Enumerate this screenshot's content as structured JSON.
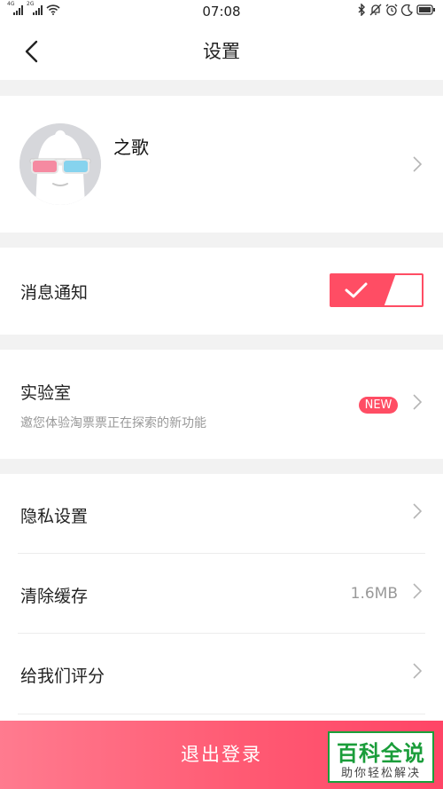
{
  "status_bar": {
    "network_1": "4G",
    "network_2": "2G",
    "time": "07:08"
  },
  "header": {
    "title": "设置",
    "back_icon": "chevron-left-icon"
  },
  "profile": {
    "name": "之歌",
    "avatar_icon": "avatar-mascot-3d-glasses"
  },
  "notifications": {
    "label": "消息通知",
    "toggle_on": true
  },
  "lab": {
    "label": "实验室",
    "subtitle": "邀您体验淘票票正在探索的新功能",
    "badge": "NEW"
  },
  "list": {
    "items": [
      {
        "label": "隐私设置",
        "value": ""
      },
      {
        "label": "清除缓存",
        "value": "1.6MB"
      },
      {
        "label": "给我们评分",
        "value": ""
      }
    ]
  },
  "logout": {
    "label": "退出登录"
  },
  "watermark": {
    "main": "百科全说",
    "sub": "助你轻松解决"
  },
  "colors": {
    "accent": "#ff4d64",
    "background": "#f2f2f2",
    "watermark_green": "#1a9d3a"
  }
}
